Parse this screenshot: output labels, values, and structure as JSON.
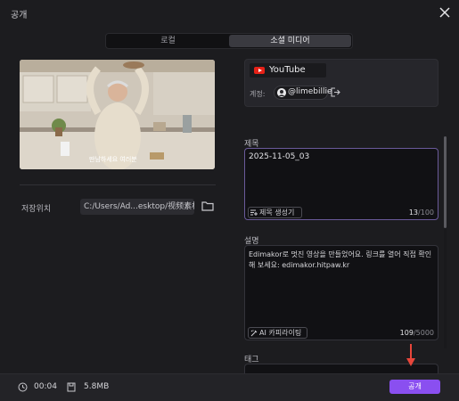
{
  "window": {
    "title": "공개"
  },
  "tabs": [
    {
      "label": "로컬",
      "active": false
    },
    {
      "label": "소셜 미디어",
      "active": true
    }
  ],
  "preview": {
    "caption": "딴남하세요 여러분"
  },
  "save_location": {
    "label": "저장위치",
    "path": "C:/Users/Ad...esktop/视频素材"
  },
  "account": {
    "platform": "YouTube",
    "account_label": "계정:",
    "account_name": "@limebillie"
  },
  "title_field": {
    "label": "제목",
    "value": "2025-11-05_03",
    "generate_button": "제목 생성기",
    "count": "13",
    "max": "/100"
  },
  "description_field": {
    "label": "설명",
    "value": "Edimakor로 멋진 영상을 만들었어요. 링크를 열어 직접 확인해 보세요: edimakor.hitpaw.kr",
    "ai_button": "AI 카피라이팅",
    "count": "109",
    "max": "/5000"
  },
  "tag_field": {
    "label": "태그"
  },
  "footer": {
    "duration": "00:04",
    "size": "5.8MB",
    "publish_button": "공개"
  },
  "colors": {
    "accent": "#8a4ff0",
    "youtube_red": "#e62117",
    "background": "#1c1c1f",
    "annotation_arrow": "#e8463b"
  },
  "icons": [
    "close-icon",
    "folder-icon",
    "youtube-icon",
    "avatar",
    "logout-icon",
    "title-generator-icon",
    "ai-icon",
    "clock-icon",
    "file-icon",
    "arrow-icon"
  ]
}
